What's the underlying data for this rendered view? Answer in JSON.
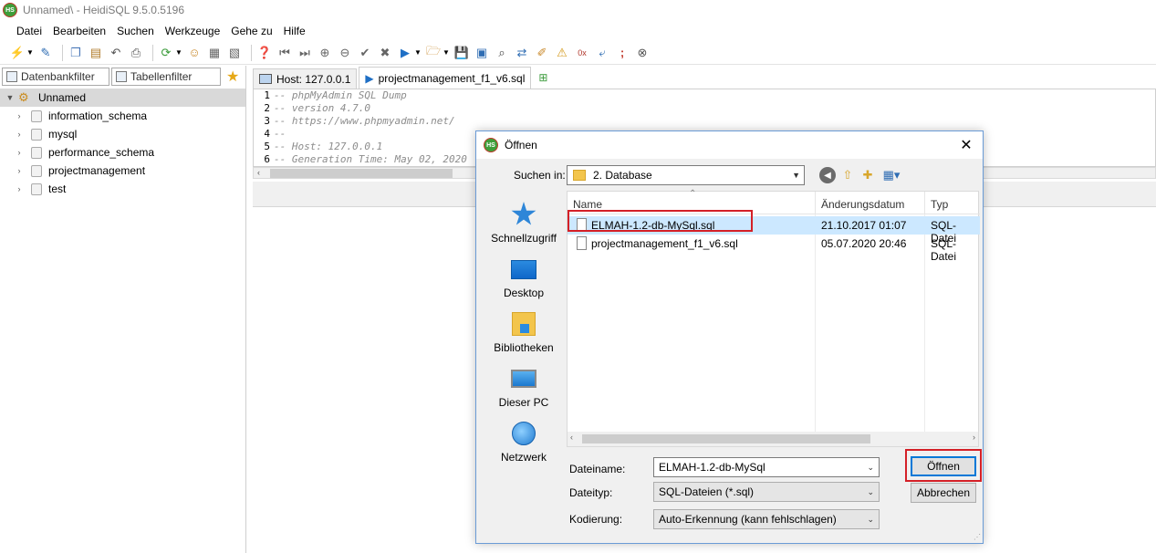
{
  "window": {
    "title": "Unnamed\\ - HeidiSQL 9.5.0.5196",
    "app_icon": "HS"
  },
  "menu": [
    "Datei",
    "Bearbeiten",
    "Suchen",
    "Werkzeuge",
    "Gehe zu",
    "Hilfe"
  ],
  "left_panel": {
    "filter_db": "Datenbankfilter",
    "filter_table": "Tabellenfilter",
    "root": "Unnamed",
    "databases": [
      "information_schema",
      "mysql",
      "performance_schema",
      "projectmanagement",
      "test"
    ]
  },
  "tabs": [
    {
      "label": "Host: 127.0.0.1"
    },
    {
      "label": "projectmanagement_f1_v6.sql"
    }
  ],
  "editor": {
    "lines": [
      {
        "n": "1",
        "text": "-- phpMyAdmin SQL Dump"
      },
      {
        "n": "2",
        "text": "-- version 4.7.0"
      },
      {
        "n": "3",
        "text": "-- https://www.phpmyadmin.net/"
      },
      {
        "n": "4",
        "text": "--"
      },
      {
        "n": "5",
        "text": "-- Host: 127.0.0.1"
      },
      {
        "n": "6",
        "text": "-- Generation Time: May 02, 2020"
      }
    ]
  },
  "dialog": {
    "title": "Öffnen",
    "look_in_label": "Suchen in:",
    "look_in_value": "2. Database",
    "places": [
      "Schnellzugriff",
      "Desktop",
      "Bibliotheken",
      "Dieser PC",
      "Netzwerk"
    ],
    "columns": {
      "name": "Name",
      "date": "Änderungsdatum",
      "type": "Typ"
    },
    "files": [
      {
        "name": "ELMAH-1.2-db-MySql.sql",
        "date": "21.10.2017 01:07",
        "type": "SQL-Datei"
      },
      {
        "name": "projectmanagement_f1_v6.sql",
        "date": "05.07.2020 20:46",
        "type": "SQL-Datei"
      }
    ],
    "filename_label": "Dateiname:",
    "filename_value": "ELMAH-1.2-db-MySql",
    "filetype_label": "Dateityp:",
    "filetype_value": "SQL-Dateien (*.sql)",
    "encoding_label": "Kodierung:",
    "encoding_value": "Auto-Erkennung (kann fehlschlagen)",
    "open_button": "Öffnen",
    "cancel_button": "Abbrechen"
  },
  "colors": {
    "highlight": "#d42027",
    "selection": "#cce8ff",
    "accent": "#0078d7"
  }
}
